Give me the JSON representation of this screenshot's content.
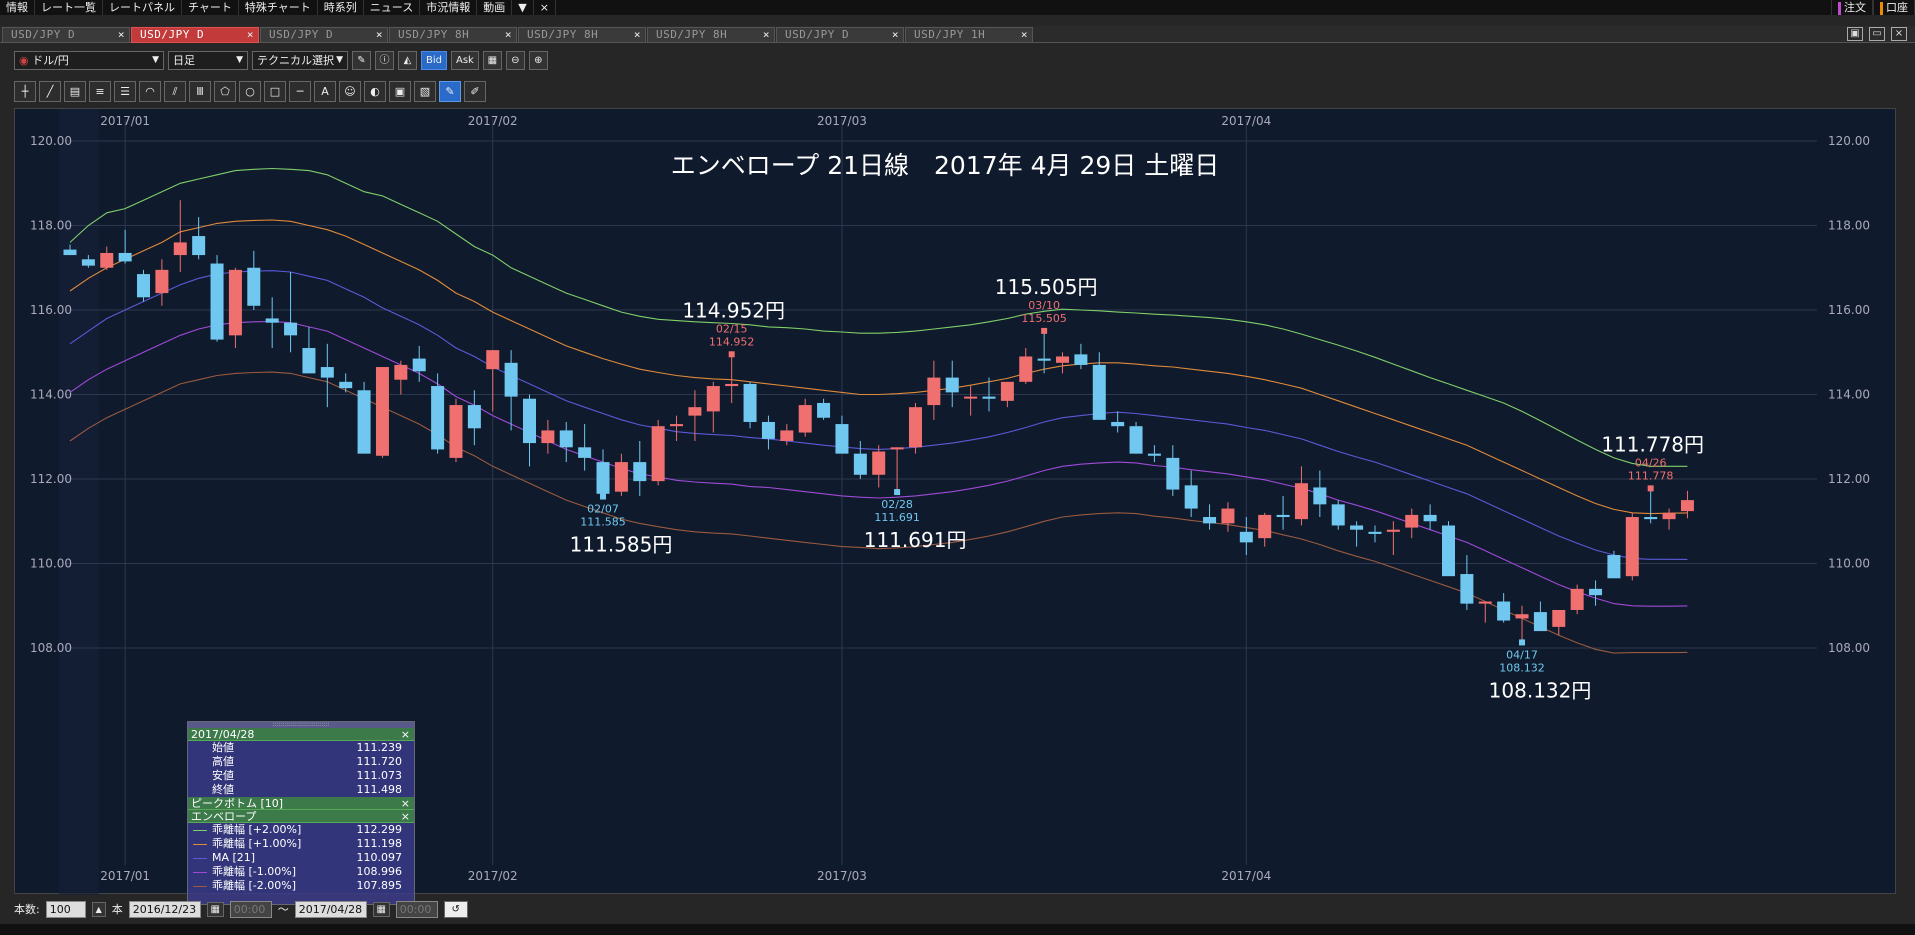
{
  "menu": {
    "items": [
      "情報",
      "レート一覧",
      "レートパネル",
      "チャート",
      "特殊チャート",
      "時系列",
      "ニュース",
      "市況情報",
      "動画"
    ],
    "more": "▼",
    "close": "×",
    "right": [
      "注文",
      "口座"
    ]
  },
  "tabs": [
    {
      "label": "USD/JPY D",
      "active": false
    },
    {
      "label": "USD/JPY D",
      "active": true
    },
    {
      "label": "USD/JPY D",
      "active": false
    },
    {
      "label": "USD/JPY 8H",
      "active": false
    },
    {
      "label": "USD/JPY 8H",
      "active": false
    },
    {
      "label": "USD/JPY 8H",
      "active": false
    },
    {
      "label": "USD/JPY D",
      "active": false
    },
    {
      "label": "USD/JPY 1H",
      "active": false
    }
  ],
  "tab_close": "×",
  "toolbar": {
    "symbol": "ドル/円",
    "period": "日足",
    "technical": "テクニカル選択",
    "bid": "Bid",
    "ask": "Ask"
  },
  "drawtools": [
    "┼",
    "╱",
    "▤",
    "≡",
    "☰",
    "◠",
    "⫽",
    "Ⅲ",
    "⬠",
    "○",
    "□",
    "─",
    "A",
    "☺",
    "◐",
    "▣",
    "▧",
    "✎",
    "✐"
  ],
  "chart_data": {
    "type": "candlestick",
    "title": "エンベロープ 21日線　2017年 4月 29日 土曜日",
    "ylim": [
      106.7,
      121.0
    ],
    "y_ticks": [
      "120.00",
      "118.00",
      "116.00",
      "114.00",
      "112.00",
      "110.00",
      "108.00"
    ],
    "x_ticks": [
      {
        "label": "2017/01",
        "idx": 3
      },
      {
        "label": "2017/02",
        "idx": 23
      },
      {
        "label": "2017/03",
        "idx": 42
      },
      {
        "label": "2017/04",
        "idx": 64
      }
    ],
    "up_color": "#f07070",
    "down_color": "#70c8f0",
    "candles": [
      [
        117.43,
        117.55,
        117.3,
        117.3
      ],
      [
        117.2,
        117.3,
        117.0,
        117.05
      ],
      [
        117.0,
        117.5,
        116.95,
        117.35
      ],
      [
        117.35,
        117.9,
        117.1,
        117.15
      ],
      [
        116.85,
        116.95,
        116.2,
        116.3
      ],
      [
        116.4,
        117.2,
        116.1,
        116.95
      ],
      [
        117.3,
        118.6,
        116.9,
        117.6
      ],
      [
        117.75,
        118.2,
        117.2,
        117.3
      ],
      [
        117.1,
        117.3,
        115.25,
        115.3
      ],
      [
        115.4,
        117.0,
        115.1,
        116.95
      ],
      [
        117.0,
        117.4,
        116.0,
        116.1
      ],
      [
        115.8,
        116.3,
        115.1,
        115.7
      ],
      [
        115.7,
        116.9,
        115.0,
        115.4
      ],
      [
        115.1,
        115.6,
        114.6,
        114.5
      ],
      [
        114.65,
        115.2,
        113.7,
        114.4
      ],
      [
        114.3,
        114.5,
        114.05,
        114.15
      ],
      [
        114.1,
        114.3,
        112.6,
        112.6
      ],
      [
        112.55,
        114.65,
        112.5,
        114.65
      ],
      [
        114.35,
        114.8,
        114.0,
        114.7
      ],
      [
        114.85,
        115.15,
        114.3,
        114.55
      ],
      [
        114.2,
        114.5,
        112.6,
        112.7
      ],
      [
        112.5,
        113.9,
        112.4,
        113.75
      ],
      [
        113.75,
        114.1,
        112.8,
        113.2
      ],
      [
        114.6,
        115.05,
        113.6,
        115.05
      ],
      [
        114.75,
        115.05,
        113.15,
        113.95
      ],
      [
        113.9,
        114.0,
        112.3,
        112.85
      ],
      [
        112.85,
        113.4,
        112.6,
        113.15
      ],
      [
        113.15,
        113.35,
        112.4,
        112.75
      ],
      [
        112.75,
        113.3,
        112.2,
        112.5
      ],
      [
        112.4,
        112.7,
        111.585,
        111.65
      ],
      [
        111.7,
        112.6,
        111.6,
        112.4
      ],
      [
        112.4,
        112.9,
        111.6,
        111.95
      ],
      [
        111.95,
        113.4,
        111.85,
        113.25
      ],
      [
        113.25,
        113.5,
        112.9,
        113.3
      ],
      [
        113.5,
        114.1,
        112.9,
        113.7
      ],
      [
        113.6,
        114.3,
        113.1,
        114.2
      ],
      [
        114.2,
        114.952,
        113.8,
        114.25
      ],
      [
        114.25,
        114.3,
        113.2,
        113.35
      ],
      [
        113.35,
        113.5,
        112.7,
        112.95
      ],
      [
        112.9,
        113.3,
        112.8,
        113.15
      ],
      [
        113.1,
        113.9,
        113.0,
        113.75
      ],
      [
        113.8,
        113.9,
        113.4,
        113.45
      ],
      [
        113.3,
        113.5,
        112.6,
        112.6
      ],
      [
        112.6,
        112.9,
        112.0,
        112.1
      ],
      [
        112.1,
        112.8,
        111.8,
        112.65
      ],
      [
        112.7,
        112.75,
        111.691,
        112.75
      ],
      [
        112.75,
        113.8,
        112.6,
        113.7
      ],
      [
        113.75,
        114.8,
        113.4,
        114.4
      ],
      [
        114.4,
        114.8,
        113.7,
        114.05
      ],
      [
        113.95,
        114.2,
        113.5,
        113.95
      ],
      [
        113.95,
        114.4,
        113.6,
        113.9
      ],
      [
        113.85,
        114.3,
        113.7,
        114.3
      ],
      [
        114.3,
        115.1,
        114.25,
        114.9
      ],
      [
        114.85,
        115.505,
        114.5,
        114.8
      ],
      [
        114.75,
        115.0,
        114.5,
        114.9
      ],
      [
        114.95,
        115.2,
        114.6,
        114.7
      ],
      [
        114.7,
        115.0,
        113.4,
        113.4
      ],
      [
        113.35,
        113.6,
        113.1,
        113.25
      ],
      [
        113.25,
        113.35,
        112.6,
        112.6
      ],
      [
        112.6,
        112.8,
        112.4,
        112.55
      ],
      [
        112.5,
        112.8,
        111.6,
        111.75
      ],
      [
        111.85,
        112.2,
        111.1,
        111.3
      ],
      [
        111.1,
        111.4,
        110.8,
        110.95
      ],
      [
        110.95,
        111.45,
        110.75,
        111.3
      ],
      [
        110.75,
        111.1,
        110.2,
        110.5
      ],
      [
        110.6,
        111.2,
        110.4,
        111.15
      ],
      [
        111.15,
        111.6,
        110.8,
        111.1
      ],
      [
        111.05,
        112.3,
        110.9,
        111.9
      ],
      [
        111.8,
        112.2,
        111.1,
        111.4
      ],
      [
        111.4,
        111.5,
        110.8,
        110.9
      ],
      [
        110.9,
        111.0,
        110.4,
        110.8
      ],
      [
        110.75,
        110.9,
        110.5,
        110.7
      ],
      [
        110.75,
        111.0,
        110.2,
        110.8
      ],
      [
        110.85,
        111.3,
        110.6,
        111.15
      ],
      [
        111.15,
        111.4,
        110.8,
        111.0
      ],
      [
        110.9,
        111.0,
        109.8,
        109.7
      ],
      [
        109.75,
        110.2,
        108.9,
        109.05
      ],
      [
        109.05,
        109.1,
        108.6,
        109.1
      ],
      [
        109.1,
        109.3,
        108.6,
        108.65
      ],
      [
        108.7,
        109.0,
        108.132,
        108.8
      ],
      [
        108.85,
        109.1,
        108.4,
        108.4
      ],
      [
        108.5,
        108.9,
        108.3,
        108.9
      ],
      [
        108.9,
        109.5,
        108.8,
        109.4
      ],
      [
        109.4,
        109.6,
        109.0,
        109.25
      ],
      [
        110.2,
        110.3,
        109.7,
        109.65
      ],
      [
        109.7,
        111.2,
        109.6,
        111.1
      ],
      [
        111.1,
        111.778,
        110.95,
        111.05
      ],
      [
        111.05,
        111.3,
        110.8,
        111.2
      ],
      [
        111.24,
        111.72,
        111.07,
        111.5
      ]
    ],
    "lines": [
      {
        "name": "乖離幅 [+2.00%]",
        "color": "#7fcf6a",
        "values": [
          117.6,
          118.0,
          118.3,
          118.4,
          118.6,
          118.8,
          119.0,
          119.1,
          119.2,
          119.3,
          119.33,
          119.35,
          119.33,
          119.3,
          119.2,
          119.0,
          118.8,
          118.7,
          118.5,
          118.3,
          118.1,
          117.8,
          117.5,
          117.3,
          117.0,
          116.8,
          116.6,
          116.4,
          116.25,
          116.1,
          115.95,
          115.85,
          115.78,
          115.75,
          115.72,
          115.7,
          115.68,
          115.65,
          115.6,
          115.58,
          115.55,
          115.5,
          115.48,
          115.45,
          115.45,
          115.47,
          115.5,
          115.55,
          115.6,
          115.65,
          115.72,
          115.8,
          115.9,
          115.97,
          116.02,
          116.0,
          115.98,
          115.95,
          115.93,
          115.9,
          115.88,
          115.85,
          115.82,
          115.78,
          115.72,
          115.65,
          115.55,
          115.43,
          115.3,
          115.17,
          115.03,
          114.88,
          114.72,
          114.56,
          114.4,
          114.25,
          114.1,
          113.95,
          113.8,
          113.6,
          113.38,
          113.15,
          112.92,
          112.7,
          112.5,
          112.37,
          112.3,
          112.3,
          112.3
        ]
      },
      {
        "name": "乖離幅 [+1.00%]",
        "color": "#e08a3a",
        "values": [
          116.45,
          116.75,
          117.0,
          117.2,
          117.4,
          117.6,
          117.85,
          117.95,
          118.05,
          118.1,
          118.12,
          118.13,
          118.1,
          118.0,
          117.9,
          117.75,
          117.55,
          117.35,
          117.15,
          116.95,
          116.7,
          116.4,
          116.2,
          115.95,
          115.75,
          115.55,
          115.35,
          115.15,
          115.0,
          114.85,
          114.72,
          114.6,
          114.52,
          114.45,
          114.4,
          114.37,
          114.35,
          114.3,
          114.25,
          114.2,
          114.15,
          114.1,
          114.05,
          114.0,
          114.0,
          114.02,
          114.05,
          114.1,
          114.15,
          114.22,
          114.3,
          114.38,
          114.5,
          114.6,
          114.68,
          114.72,
          114.75,
          114.75,
          114.72,
          114.68,
          114.65,
          114.6,
          114.55,
          114.5,
          114.43,
          114.35,
          114.25,
          114.15,
          114.0,
          113.85,
          113.7,
          113.55,
          113.4,
          113.25,
          113.1,
          112.95,
          112.8,
          112.6,
          112.4,
          112.2,
          112.0,
          111.8,
          111.6,
          111.42,
          111.28,
          111.2,
          111.18,
          111.19,
          111.198
        ]
      },
      {
        "name": "MA [21]",
        "color": "#5a5ad8",
        "values": [
          115.2,
          115.5,
          115.8,
          116.0,
          116.2,
          116.4,
          116.6,
          116.75,
          116.85,
          116.9,
          116.92,
          116.93,
          116.9,
          116.8,
          116.7,
          116.5,
          116.3,
          116.05,
          115.85,
          115.65,
          115.4,
          115.1,
          114.9,
          114.65,
          114.45,
          114.25,
          114.05,
          113.85,
          113.7,
          113.55,
          113.4,
          113.28,
          113.2,
          113.12,
          113.08,
          113.05,
          113.03,
          112.98,
          112.95,
          112.9,
          112.85,
          112.8,
          112.76,
          112.72,
          112.7,
          112.72,
          112.75,
          112.8,
          112.85,
          112.92,
          113.0,
          113.1,
          113.22,
          113.35,
          113.45,
          113.5,
          113.55,
          113.58,
          113.55,
          113.5,
          113.45,
          113.4,
          113.35,
          113.3,
          113.22,
          113.15,
          113.05,
          112.95,
          112.8,
          112.65,
          112.52,
          112.4,
          112.25,
          112.1,
          111.95,
          111.8,
          111.65,
          111.45,
          111.25,
          111.05,
          110.85,
          110.65,
          110.48,
          110.32,
          110.2,
          110.12,
          110.1,
          110.1,
          110.097
        ]
      },
      {
        "name": "乖離幅 [-1.00%]",
        "color": "#a04ad8",
        "values": [
          114.05,
          114.35,
          114.6,
          114.8,
          115.0,
          115.2,
          115.4,
          115.55,
          115.65,
          115.7,
          115.72,
          115.73,
          115.7,
          115.6,
          115.5,
          115.3,
          115.1,
          114.9,
          114.7,
          114.5,
          114.25,
          113.95,
          113.75,
          113.5,
          113.3,
          113.1,
          112.9,
          112.7,
          112.55,
          112.4,
          112.25,
          112.12,
          112.05,
          111.97,
          111.93,
          111.9,
          111.88,
          111.82,
          111.8,
          111.75,
          111.7,
          111.65,
          111.6,
          111.57,
          111.55,
          111.57,
          111.6,
          111.65,
          111.7,
          111.77,
          111.85,
          111.95,
          112.07,
          112.2,
          112.3,
          112.35,
          112.38,
          112.4,
          112.38,
          112.32,
          112.28,
          112.22,
          112.17,
          112.12,
          112.05,
          111.98,
          111.88,
          111.78,
          111.65,
          111.5,
          111.38,
          111.25,
          111.1,
          110.95,
          110.8,
          110.65,
          110.5,
          110.3,
          110.1,
          109.9,
          109.7,
          109.5,
          109.33,
          109.18,
          109.05,
          109.0,
          108.99,
          108.99,
          108.996
        ]
      },
      {
        "name": "乖離幅 [-2.00%]",
        "color": "#9a5a40",
        "values": [
          112.9,
          113.2,
          113.45,
          113.65,
          113.85,
          114.05,
          114.25,
          114.35,
          114.45,
          114.5,
          114.52,
          114.53,
          114.5,
          114.4,
          114.3,
          114.1,
          113.9,
          113.7,
          113.5,
          113.3,
          113.05,
          112.75,
          112.55,
          112.3,
          112.1,
          111.9,
          111.7,
          111.5,
          111.35,
          111.2,
          111.05,
          110.95,
          110.87,
          110.8,
          110.75,
          110.72,
          110.7,
          110.65,
          110.6,
          110.55,
          110.5,
          110.45,
          110.4,
          110.38,
          110.35,
          110.37,
          110.4,
          110.45,
          110.5,
          110.57,
          110.65,
          110.75,
          110.87,
          111.0,
          111.1,
          111.15,
          111.18,
          111.2,
          111.18,
          111.12,
          111.08,
          111.02,
          110.97,
          110.92,
          110.85,
          110.78,
          110.68,
          110.58,
          110.45,
          110.3,
          110.17,
          110.05,
          109.9,
          109.75,
          109.6,
          109.45,
          109.3,
          109.1,
          108.9,
          108.7,
          108.5,
          108.3,
          108.12,
          107.97,
          107.88,
          107.89,
          107.89,
          107.89,
          107.895
        ]
      }
    ],
    "peaks": [
      {
        "idx": 36,
        "type": "high",
        "date": "02/15",
        "price": "114.952",
        "big": "114.952円"
      },
      {
        "idx": 53,
        "type": "high",
        "date": "03/10",
        "price": "115.505",
        "big": "115.505円"
      },
      {
        "idx": 86,
        "type": "high",
        "date": "04/26",
        "price": "111.778",
        "big": "111.778円"
      },
      {
        "idx": 29,
        "type": "low",
        "date": "02/07",
        "price": "111.585",
        "big": "111.585円"
      },
      {
        "idx": 45,
        "type": "low",
        "date": "02/28",
        "price": "111.691",
        "big": "111.691円"
      },
      {
        "idx": 79,
        "type": "low",
        "date": "04/17",
        "price": "108.132",
        "big": "108.132円"
      }
    ]
  },
  "info_panel": {
    "date": "2017/04/28",
    "close": "×",
    "ohlc": [
      {
        "k": "始値",
        "v": "111.239"
      },
      {
        "k": "高値",
        "v": "111.720"
      },
      {
        "k": "安値",
        "v": "111.073"
      },
      {
        "k": "終値",
        "v": "111.498"
      }
    ],
    "peak_label": "ピークボトム [10]",
    "env_label": "エンベロープ",
    "env": [
      {
        "k": "乖離幅 [+2.00%]",
        "v": "112.299",
        "color": "#7fcf6a"
      },
      {
        "k": "乖離幅 [+1.00%]",
        "v": "111.198",
        "color": "#e08a3a"
      },
      {
        "k": "MA [21]",
        "v": "110.097",
        "color": "#5a5ad8"
      },
      {
        "k": "乖離幅 [-1.00%]",
        "v": "108.996",
        "color": "#a04ad8"
      },
      {
        "k": "乖離幅 [-2.00%]",
        "v": "107.895",
        "color": "#9a5a40"
      }
    ]
  },
  "bottom": {
    "count_label": "本数:",
    "count": "100",
    "unit": "本",
    "from": "2016/12/23",
    "from_time": "00:00",
    "tilde": "〜",
    "to": "2017/04/28",
    "to_time": "00:00"
  }
}
